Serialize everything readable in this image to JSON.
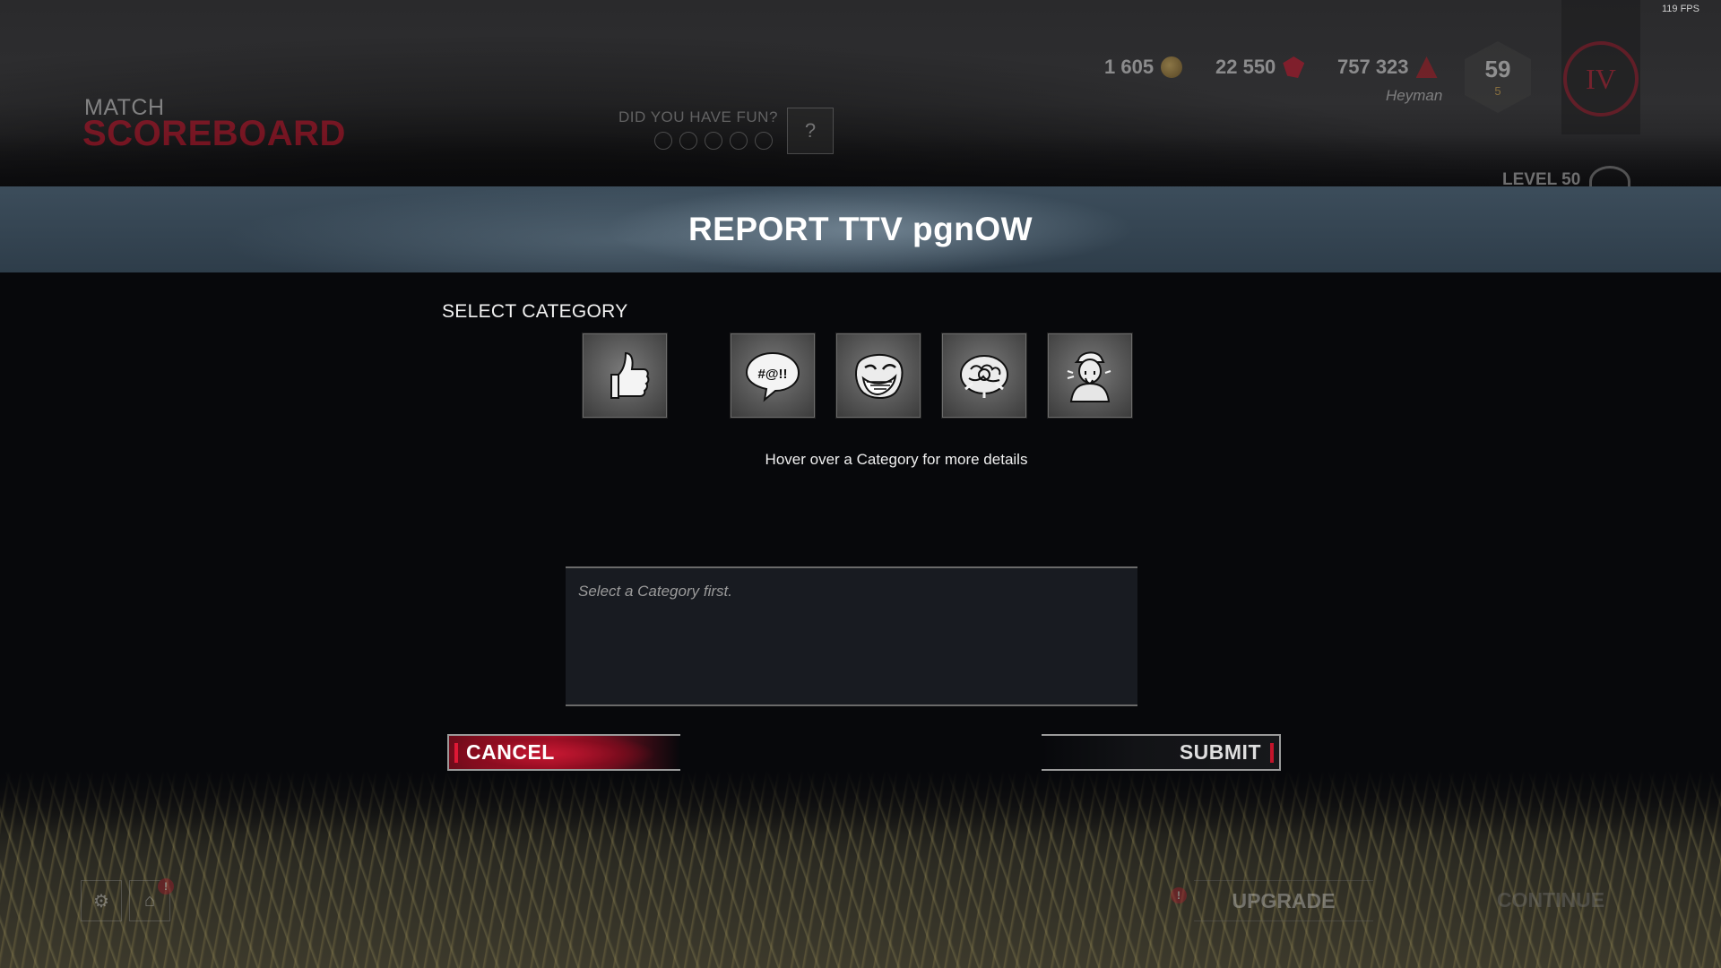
{
  "fps": "119 FPS",
  "header": {
    "match_label": "MATCH",
    "scoreboard_label": "SCOREBOARD",
    "fun_question": "DID YOU HAVE FUN?",
    "fun_button_icon": "?",
    "currencies": [
      {
        "value": "1 605",
        "icon": "iridescent-shard-coin-icon"
      },
      {
        "value": "22 550",
        "icon": "auric-cell-icon"
      },
      {
        "value": "757 323",
        "icon": "bloodpoints-icon"
      }
    ],
    "player_name": "Heyman",
    "grade": {
      "number": "59",
      "sub": "5"
    },
    "rank_emblem": "IV",
    "level_label": "LEVEL 50"
  },
  "report": {
    "title": "REPORT TTV pgnOW",
    "select_label": "SELECT CATEGORY",
    "categories": [
      {
        "icon": "thumbs-up-icon"
      },
      {
        "icon": "swearing-speech-bubble-icon",
        "text": "#@!!"
      },
      {
        "icon": "troll-face-icon"
      },
      {
        "icon": "brain-cheat-icon"
      },
      {
        "icon": "crying-player-icon"
      }
    ],
    "hint": "Hover over a Category for more details",
    "details_placeholder": "Select a Category first.",
    "cancel_label": "CANCEL",
    "submit_label": "SUBMIT"
  },
  "footer": {
    "upgrade_label": "UPGRADE",
    "continue_label": "CONTINUE",
    "alert_glyph": "!"
  },
  "colors": {
    "accent_red": "#c2142a",
    "title_band": "#3c4d5b",
    "panel_bg": "#07080b"
  }
}
